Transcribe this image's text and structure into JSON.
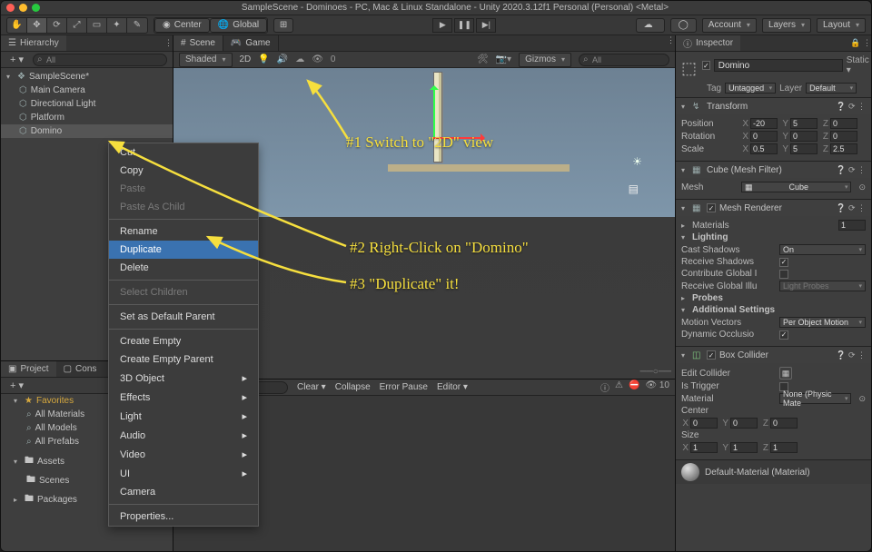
{
  "window": {
    "title": "SampleScene - Dominoes - PC, Mac & Linux Standalone - Unity 2020.3.12f1 Personal (Personal) <Metal>"
  },
  "toolbar": {
    "pivot": "Center",
    "handle": "Global",
    "cloud": "",
    "account": "Account",
    "layers": "Layers",
    "layout": "Layout"
  },
  "hierarchy": {
    "tab": "Hierarchy",
    "search": "All",
    "scene": "SampleScene*",
    "items": [
      "Main Camera",
      "Directional Light",
      "Platform",
      "Domino"
    ]
  },
  "project": {
    "tabs": [
      "Project",
      "Cons"
    ],
    "favorites": "Favorites",
    "favItems": [
      "All Materials",
      "All Models",
      "All Prefabs"
    ],
    "assets": "Assets",
    "assetChildren": [
      "Scenes"
    ],
    "packages": "Packages"
  },
  "sceneTabs": {
    "scene": "Scene",
    "game": "Game"
  },
  "sceneTools": {
    "shading": "Shaded",
    "twoD": "2D",
    "gizmos": "Gizmos",
    "search": "All"
  },
  "consoleBar": {
    "clear": "Clear",
    "collapse": "Collapse",
    "errpause": "Error Pause",
    "editor": "Editor"
  },
  "ctx": {
    "cut": "Cut",
    "copy": "Copy",
    "paste": "Paste",
    "pasteChild": "Paste As Child",
    "rename": "Rename",
    "duplicate": "Duplicate",
    "delete": "Delete",
    "selChildren": "Select Children",
    "defaultParent": "Set as Default Parent",
    "createEmpty": "Create Empty",
    "createEmptyParent": "Create Empty Parent",
    "obj3d": "3D Object",
    "effects": "Effects",
    "light": "Light",
    "audio": "Audio",
    "video": "Video",
    "ui": "UI",
    "camera": "Camera",
    "props": "Properties..."
  },
  "inspector": {
    "tab": "Inspector",
    "name": "Domino",
    "static": "Static",
    "tagLabel": "Tag",
    "tag": "Untagged",
    "layerLabel": "Layer",
    "layer": "Default",
    "transform": {
      "title": "Transform",
      "position": "Position",
      "rotation": "Rotation",
      "scale": "Scale",
      "pos": {
        "x": "-20",
        "y": "5",
        "z": "0"
      },
      "rot": {
        "x": "0",
        "y": "0",
        "z": "0"
      },
      "scl": {
        "x": "0.5",
        "y": "5",
        "z": "2.5"
      }
    },
    "meshFilter": {
      "title": "Cube (Mesh Filter)",
      "meshLabel": "Mesh",
      "mesh": "Cube"
    },
    "meshRenderer": {
      "title": "Mesh Renderer",
      "materials": "Materials",
      "matCount": "1",
      "lighting": "Lighting",
      "castShadows": "Cast Shadows",
      "castVal": "On",
      "recvShadows": "Receive Shadows",
      "contrib": "Contribute Global I",
      "recvGI": "Receive Global Illu",
      "recvGIVal": "Light Probes",
      "probes": "Probes",
      "addSettings": "Additional Settings",
      "motion": "Motion Vectors",
      "motionVal": "Per Object Motion",
      "dynOcc": "Dynamic Occlusio"
    },
    "boxCollider": {
      "title": "Box Collider",
      "editCollider": "Edit Collider",
      "isTrigger": "Is Trigger",
      "material": "Material",
      "matVal": "None (Physic Mate",
      "center": "Center",
      "size": "Size",
      "c": {
        "x": "0",
        "y": "0",
        "z": "0"
      },
      "s": {
        "x": "1",
        "y": "1",
        "z": "1"
      }
    },
    "matPreview": "Default-Material (Material)"
  },
  "annotations": {
    "a1": "#1  Switch to \"2D\" view",
    "a2": "#2  Right-Click on \"Domino\"",
    "a3": "#3  \"Duplicate\" it!"
  },
  "console": {
    "vis": "10"
  }
}
